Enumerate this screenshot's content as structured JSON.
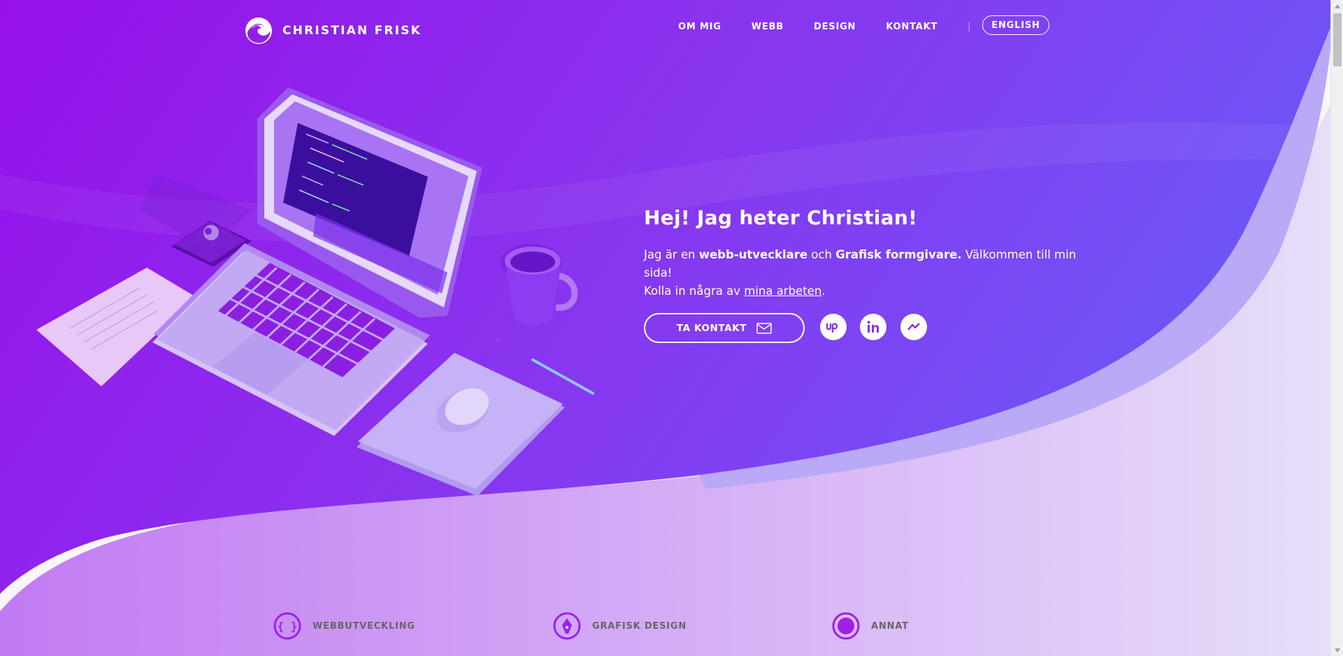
{
  "brand": {
    "name": "CHRISTIAN FRISK"
  },
  "nav": {
    "items": [
      "OM MIG",
      "WEBB",
      "DESIGN",
      "KONTAKT"
    ],
    "separator": "|",
    "language_button": "ENGLISH"
  },
  "hero": {
    "title": "Hej! Jag heter Christian!",
    "line1_a": "Jag är en ",
    "line1_b": "webb-utvecklare",
    "line1_c": " och ",
    "line1_d": "Grafisk formgivare.",
    "line1_e": " Välkommen till min sida!",
    "line2_a": "Kolla in några av ",
    "line2_link": "mina arbeten",
    "line2_b": ".",
    "cta_label": "TA KONTAKT",
    "socials": [
      {
        "icon": "upwork-icon"
      },
      {
        "icon": "linkedin-icon"
      },
      {
        "icon": "messenger-icon"
      }
    ]
  },
  "services": [
    {
      "label": "WEBBUTVECKLING",
      "icon": "code-braces-icon"
    },
    {
      "label": "GRAFISK DESIGN",
      "icon": "pen-nib-icon"
    },
    {
      "label": "ANNAT",
      "icon": "circle-icon"
    }
  ],
  "colors": {
    "purple": "#9b14ec",
    "violet": "#7b4cf6",
    "lavender": "#bfb3f5"
  }
}
